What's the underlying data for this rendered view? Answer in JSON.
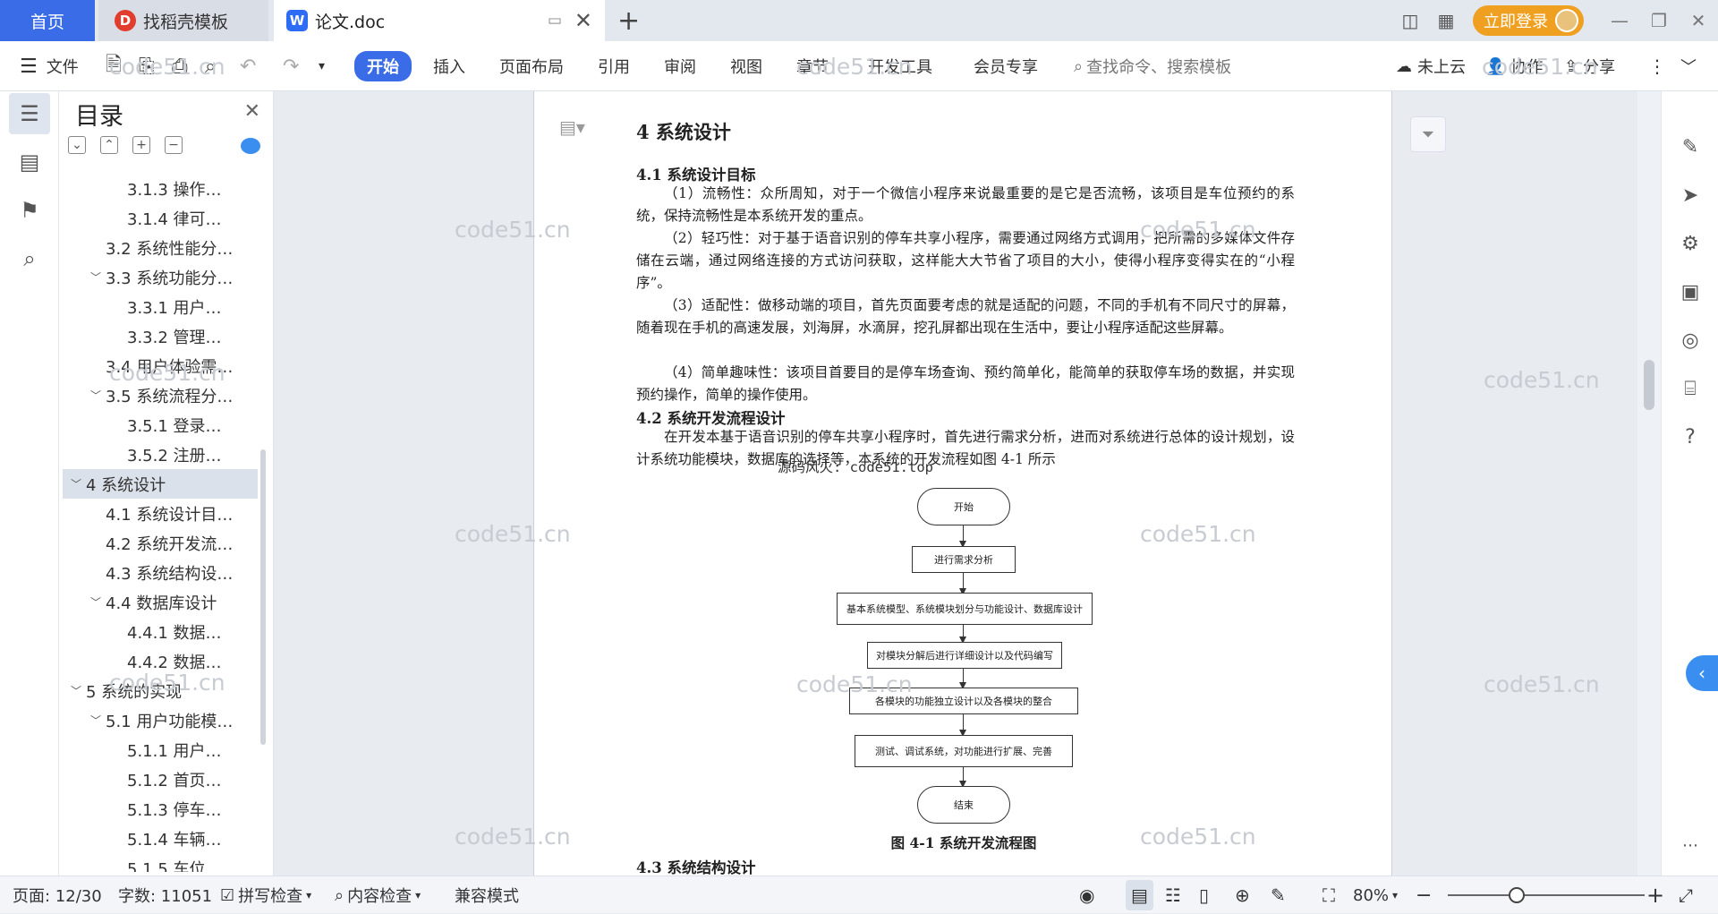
{
  "tabs": {
    "home": "首页",
    "daoke": "找稻壳模板",
    "doc": "论文.doc",
    "daoke_logo": "D",
    "doc_logo": "W"
  },
  "titlebar": {
    "login": "立即登录"
  },
  "toolbar": {
    "file": "文件",
    "menus": [
      "开始",
      "插入",
      "页面布局",
      "引用",
      "审阅",
      "视图",
      "章节",
      "开发工具",
      "会员专享"
    ],
    "search_placeholder": "查找命令、搜索模板",
    "cloud": "未上云",
    "collab": "协作",
    "share": "分享"
  },
  "toc": {
    "title": "目录",
    "items": [
      {
        "label": "3.1.3  操作…",
        "level": 3
      },
      {
        "label": "3.1.4  律可…",
        "level": 3
      },
      {
        "label": "3.2  系统性能分…",
        "level": 2
      },
      {
        "label": "3.3  系统功能分…",
        "level": 2,
        "expanded": true
      },
      {
        "label": "3.3.1  用户…",
        "level": 3
      },
      {
        "label": "3.3.2  管理…",
        "level": 3
      },
      {
        "label": "3.4  用户体验需…",
        "level": 2
      },
      {
        "label": "3.5  系统流程分…",
        "level": 2,
        "expanded": true
      },
      {
        "label": "3.5.1  登录…",
        "level": 3
      },
      {
        "label": "3.5.2  注册…",
        "level": 3
      },
      {
        "label": "4  系统设计",
        "level": 1,
        "expanded": true,
        "selected": true
      },
      {
        "label": "4.1  系统设计目…",
        "level": 2
      },
      {
        "label": "4.2  系统开发流…",
        "level": 2
      },
      {
        "label": "4.3  系统结构设…",
        "level": 2
      },
      {
        "label": "4.4  数据库设计",
        "level": 2,
        "expanded": true
      },
      {
        "label": "4.4.1  数据…",
        "level": 3
      },
      {
        "label": "4.4.2  数据…",
        "level": 3
      },
      {
        "label": "5  系统的实现",
        "level": 1,
        "expanded": true
      },
      {
        "label": "5.1  用户功能模…",
        "level": 2,
        "expanded": true
      },
      {
        "label": "5.1.1  用户…",
        "level": 3
      },
      {
        "label": "5.1.2  首页…",
        "level": 3
      },
      {
        "label": "5.1.3  停车…",
        "level": 3
      },
      {
        "label": "5.1.4  车辆…",
        "level": 3
      },
      {
        "label": "5.1.5  车位…",
        "level": 3
      }
    ]
  },
  "doc": {
    "h1": "4  系统设计",
    "h2_1": "4.1  系统设计目标",
    "p1": "（1）流畅性：众所周知，对于一个微信小程序来说最重要的是它是否流畅，该项目是车位预约的系统，保持流畅性是本系统开发的重点。",
    "p2": "（2）轻巧性：对于基于语音识别的停车共享小程序，需要通过网络方式调用，把所需的多媒体文件存储在云端，通过网络连接的方式访问获取，这样能大大节省了项目的大小，使得小程序变得实在的“小程序”。",
    "p3": "（3）适配性：做移动端的项目，首先页面要考虑的就是适配的问题，不同的手机有不同尺寸的屏幕，随着现在手机的高速发展，刘海屏，水滴屏，挖孔屏都出现在生活中，要让小程序适配这些屏幕。",
    "p4": "（4）简单趣味性：该项目首要目的是停车场查询、预约简单化，能简单的获取停车场的数据，并实现预约操作，简单的操作使用。",
    "h2_2": "4.2  系统开发流程设计",
    "p5": "在开发本基于语音识别的停车共享小程序时，首先进行需求分析，进而对系统进行总体的设计规划，设计系统功能模块，数据库的选择等，本系统的开发流程如图 4-1 所示",
    "overlay": "源码风火: code51.top",
    "flow": [
      "开始",
      "进行需求分析",
      "基本系统模型、系统模块划分与功能设计、数据库设计",
      "对模块分解后进行详细设计以及代码编写",
      "各模块的功能独立设计以及各模块的整合",
      "测试、调试系统，对功能进行扩展、完善",
      "结束"
    ],
    "caption": "图 4-1  系统开发流程图",
    "h2_3": "4.3  系统结构设计"
  },
  "watermark": "code51.cn",
  "status": {
    "page": "页面: 12/30",
    "words": "字数: 11051",
    "spell": "拼写检查",
    "content": "内容检查",
    "compat": "兼容模式",
    "zoom": "80%"
  },
  "colors": {
    "accent": "#3a6ce8",
    "login": "#f0a020"
  }
}
